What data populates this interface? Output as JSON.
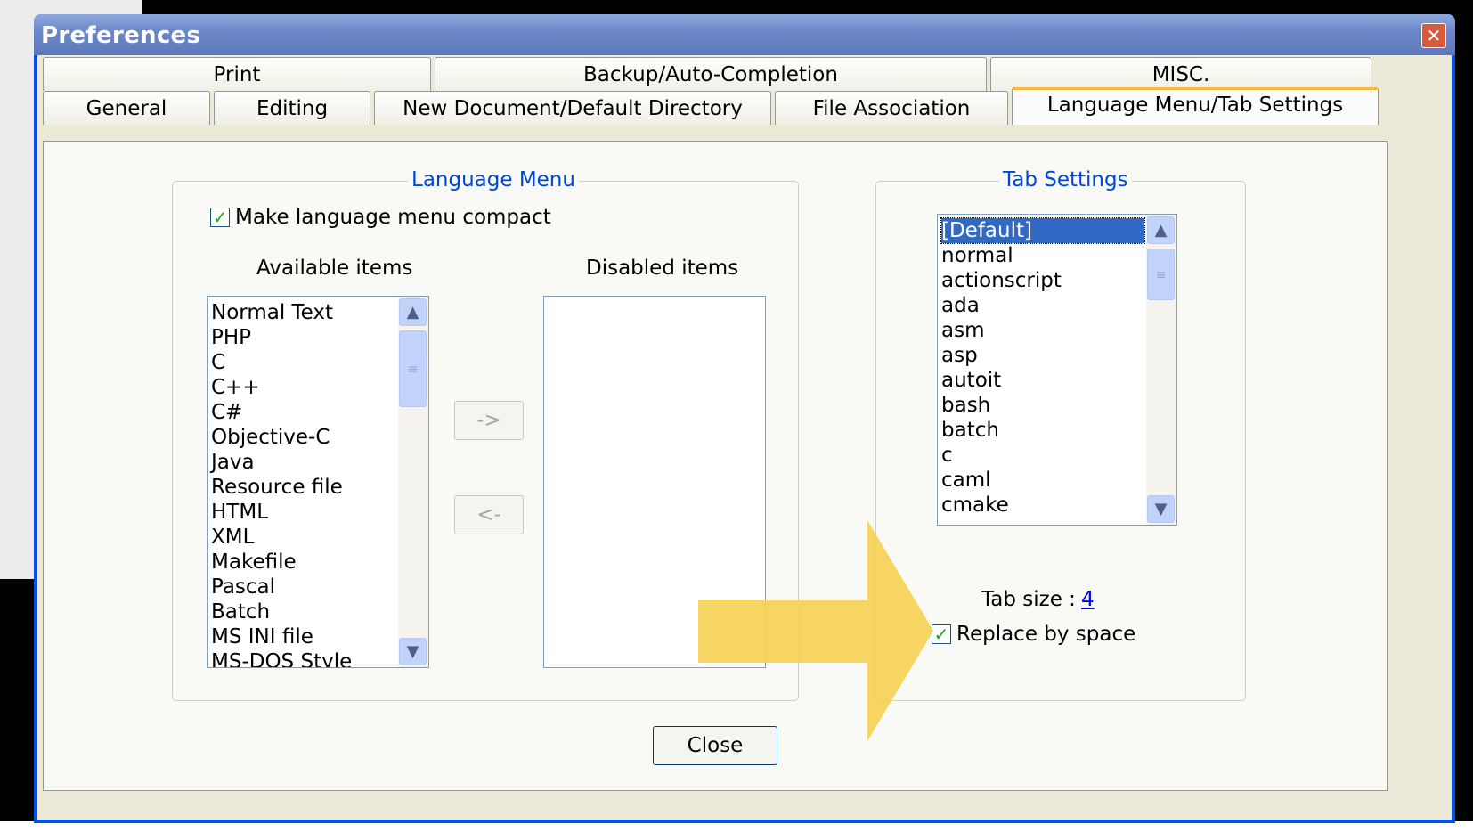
{
  "window": {
    "title": "Preferences",
    "close_symbol": "✕"
  },
  "tabs_row1": [
    "Print",
    "Backup/Auto-Completion",
    "MISC."
  ],
  "tabs_row2": [
    "General",
    "Editing",
    "New Document/Default Directory",
    "File Association",
    "Language Menu/Tab Settings"
  ],
  "active_tab": "Language Menu/Tab Settings",
  "language_menu": {
    "legend": "Language Menu",
    "compact_label": "Make language menu compact",
    "compact_checked": true,
    "available_label": "Available items",
    "disabled_label": "Disabled items",
    "available_items": [
      "Normal Text",
      "PHP",
      "C",
      "C++",
      "C#",
      "Objective-C",
      "Java",
      "Resource file",
      "HTML",
      "XML",
      "Makefile",
      "Pascal",
      "Batch",
      "MS INI file",
      "MS-DOS Style"
    ],
    "disabled_items": [],
    "move_right_label": "->",
    "move_left_label": "<-"
  },
  "tab_settings": {
    "legend": "Tab Settings",
    "languages": [
      "[Default]",
      "normal",
      "actionscript",
      "ada",
      "asm",
      "asp",
      "autoit",
      "bash",
      "batch",
      "c",
      "caml",
      "cmake"
    ],
    "selected": "[Default]",
    "tab_size_label": "Tab size :",
    "tab_size_value": "4",
    "replace_label": "Replace by space",
    "replace_checked": true
  },
  "close_button": "Close",
  "colors": {
    "title_bar": "#6d88c8",
    "legend": "#0046d5",
    "active_tab_accent": "#f5b841",
    "arrow": "#f5d35a",
    "selection": "#316ac5"
  },
  "icons": [
    "close-icon",
    "check-icon",
    "scroll-up-icon",
    "scroll-down-icon",
    "highlight-arrow-icon"
  ]
}
